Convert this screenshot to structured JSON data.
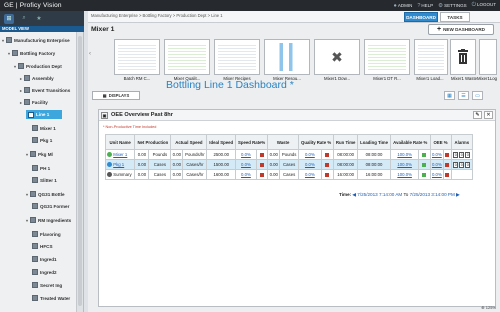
{
  "app": {
    "brand": "GE | Proficy Vision"
  },
  "topbar": {
    "admin": "ADMIN",
    "help": "HELP",
    "settings": "SETTINGS",
    "logout": "LOGOUT"
  },
  "tabs": {
    "dashboard": "DASHBOARD",
    "tasks": "TASKS"
  },
  "sidebar": {
    "header": "MODEL VIEW",
    "nodes": [
      "Manufacturing Enterprise",
      "Bottling Factory",
      "Production Dept",
      "Assembly",
      "Event Transitions",
      "Facility",
      "Line 1",
      "Mixer 1",
      "Pkg 1",
      "Pkg Ml",
      "PH 1",
      "Slitter 1",
      "QG31 Bottle",
      "QG31 Former",
      "RM Ingredients",
      "Flavoring",
      "HFCS",
      "Ingred1",
      "Ingred2",
      "Secret Ing",
      "Treated Water"
    ]
  },
  "main": {
    "breadcrumb": "Manufacturing Enterprise > Bottling Factory > Production Dept > Line 1",
    "page_title": "Mixer 1",
    "new_dashboard": "NEW DASHBOARD",
    "displays_label": "DISPLAYS",
    "dashboard_title": "Bottling Line 1 Dashboard *",
    "thumbnails": [
      "Batch RM C...",
      "Mixer Qualit...",
      "Mixer Recipes",
      "Mixer Resou...",
      "Mixer1 Dow...",
      "Mixer1 DT R...",
      "Mixer1 Load...",
      "Mixer1 Waste",
      "Mixer1Log"
    ]
  },
  "panel": {
    "title": "OEE Overview Past 8hr",
    "note": "* Non-Productive Time Included",
    "columns": [
      "Unit Name",
      "Net Production",
      "Actual Speed",
      "Ideal Speed",
      "Speed Rate%",
      "Waste",
      "Quality Rate %",
      "Run Time",
      "Loading Time",
      "Available Rate %",
      "OEE %",
      "Alarms"
    ],
    "rows": [
      {
        "name": "Mixer 1",
        "net": "0.00",
        "net_unit": "Pounds",
        "actual": "0.00",
        "actual_unit": "Pounds/hr",
        "ideal": "2500.00",
        "speed_rate": "0.0%",
        "waste": "0.00",
        "waste_unit": "Pounds",
        "quality": "0.0%",
        "run": "08:00:00",
        "loading": "08:00:00",
        "avail": "100.0%",
        "oee": "0.0%",
        "alarms": [
          "0",
          "0",
          "0"
        ]
      },
      {
        "name": "Pkg 1",
        "net": "0.00",
        "net_unit": "Cases",
        "actual": "0.00",
        "actual_unit": "Cases/hr",
        "ideal": "1500.00",
        "speed_rate": "0.0%",
        "waste": "0.00",
        "waste_unit": "Cases",
        "quality": "0.0%",
        "run": "08:00:00",
        "loading": "08:00:00",
        "avail": "100.0%",
        "oee": "0.0%",
        "alarms": [
          "0",
          "0",
          "0"
        ]
      },
      {
        "name": "Summary",
        "net": "0.00",
        "net_unit": "Cases",
        "actual": "0.00",
        "actual_unit": "Cases/hr",
        "ideal": "1600.00",
        "speed_rate": "0.0%",
        "waste": "0.00",
        "waste_unit": "Cases",
        "quality": "0.0%",
        "run": "16:00:00",
        "loading": "16:00:00",
        "avail": "100.0%",
        "oee": "0.0%",
        "alarms": []
      }
    ],
    "time_label": "Time:",
    "time_start": "7/25/2013 7:14:00 AM",
    "time_to": "To",
    "time_end": "7/25/2013 3:14:00 PM"
  },
  "zoom": "125%",
  "colors": {
    "accent": "#2e8bd0",
    "selected_node": "#3da6dd",
    "topbar": "#262a2e"
  }
}
